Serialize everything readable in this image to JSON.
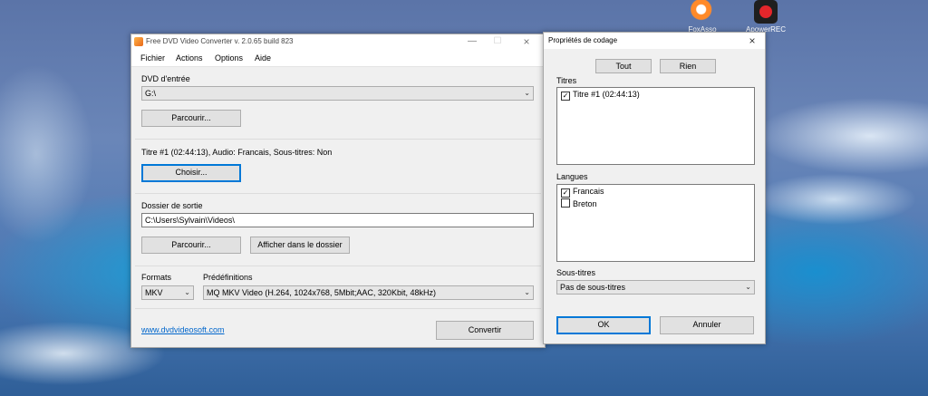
{
  "desktop_icons": [
    {
      "label": "FoxAsso",
      "icon": "fox-icon"
    },
    {
      "label": "ApowerREC",
      "icon": "record-icon"
    }
  ],
  "main_window": {
    "title": "Free DVD Video Converter  v. 2.0.65 build 823",
    "menu": [
      "Fichier",
      "Actions",
      "Options",
      "Aide"
    ],
    "dvd_input_label": "DVD d'entrée",
    "dvd_drive": "G:\\",
    "browse_label": "Parcourir...",
    "title_info": "Titre #1 (02:44:13), Audio: Francais, Sous-titres: Non",
    "choose_label": "Choisir...",
    "output_folder_label": "Dossier de sortie",
    "output_path": "C:\\Users\\Sylvain\\Videos\\",
    "browse2_label": "Parcourir...",
    "show_folder_label": "Afficher dans le dossier",
    "formats_label": "Formats",
    "format_value": "MKV",
    "presets_label": "Prédéfinitions",
    "preset_value": "MQ MKV Video (H.264, 1024x768, 5Mbit;AAC, 320Kbit, 48kHz)",
    "link": "www.dvdvideosoft.com",
    "convert_label": "Convertir"
  },
  "dialog": {
    "title": "Propriétés de codage",
    "all_label": "Tout",
    "none_label": "Rien",
    "titles_label": "Titres",
    "titles": [
      {
        "label": "Titre #1 (02:44:13)",
        "checked": true
      }
    ],
    "languages_label": "Langues",
    "languages": [
      {
        "label": "Francais",
        "checked": true
      },
      {
        "label": "Breton",
        "checked": false
      }
    ],
    "subtitles_label": "Sous-titres",
    "subtitles_value": "Pas de sous-titres",
    "ok_label": "OK",
    "cancel_label": "Annuler"
  }
}
